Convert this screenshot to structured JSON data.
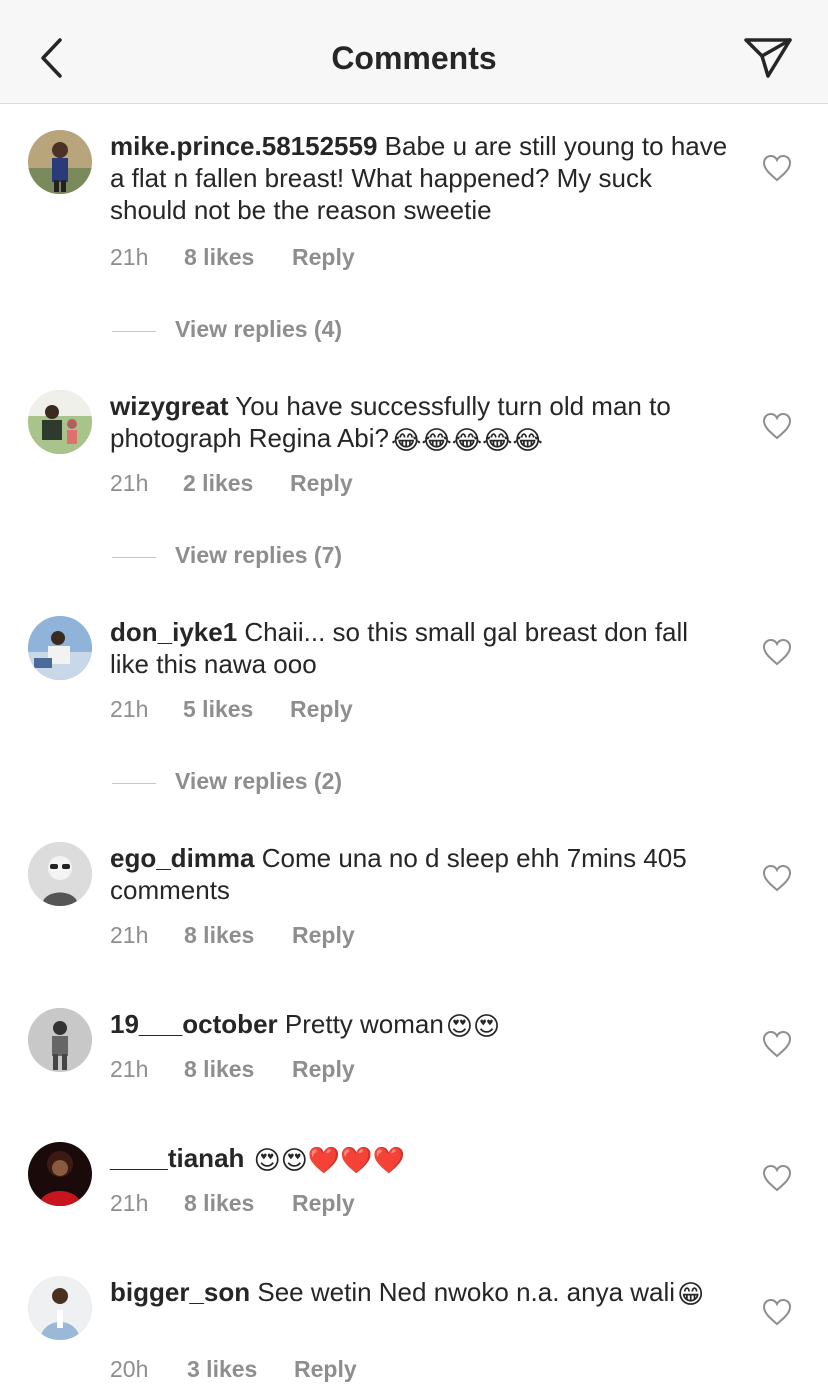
{
  "header": {
    "title": "Comments"
  },
  "comments": [
    {
      "username": "mike.prince.58152559",
      "text": "Babe u are still young to have a flat n fallen breast! What happened? My suck should not be the reason sweetie",
      "time": "21h",
      "likes": "8 likes",
      "reply": "Reply",
      "view_replies": "View replies (4)"
    },
    {
      "username": "wizygreat",
      "text": "You have successfully turn old man to photograph Regina Abi?",
      "emojis": "😂😂😂😂😂",
      "time": "21h",
      "likes": "2 likes",
      "reply": "Reply",
      "view_replies": "View replies (7)"
    },
    {
      "username": "don_iyke1",
      "text": "Chaii... so this small gal breast don fall like this nawa ooo",
      "time": "21h",
      "likes": "5 likes",
      "reply": "Reply",
      "view_replies": "View replies (2)"
    },
    {
      "username": "ego_dimma",
      "text": "Come una no d sleep ehh 7mins 405 comments",
      "time": "21h",
      "likes": "8 likes",
      "reply": "Reply"
    },
    {
      "username": "19___october",
      "text": "Pretty woman",
      "emojis": "😍😍",
      "time": "21h",
      "likes": "8 likes",
      "reply": "Reply"
    },
    {
      "username": "____tianah",
      "text": "",
      "emojis": "😍😍❤️❤️❤️",
      "time": "21h",
      "likes": "8 likes",
      "reply": "Reply"
    },
    {
      "username": "bigger_son",
      "text": "See wetin Ned nwoko n.a. anya wali",
      "emojis": "😁",
      "time": "20h",
      "likes": "3 likes",
      "reply": "Reply"
    }
  ],
  "icons": {
    "back": "chevron-left-icon",
    "send": "paper-plane-icon",
    "like": "heart-outline-icon"
  },
  "colors": {
    "text": "#262626",
    "secondary": "#8e8e8e",
    "header_bg": "#f7f7f7"
  }
}
